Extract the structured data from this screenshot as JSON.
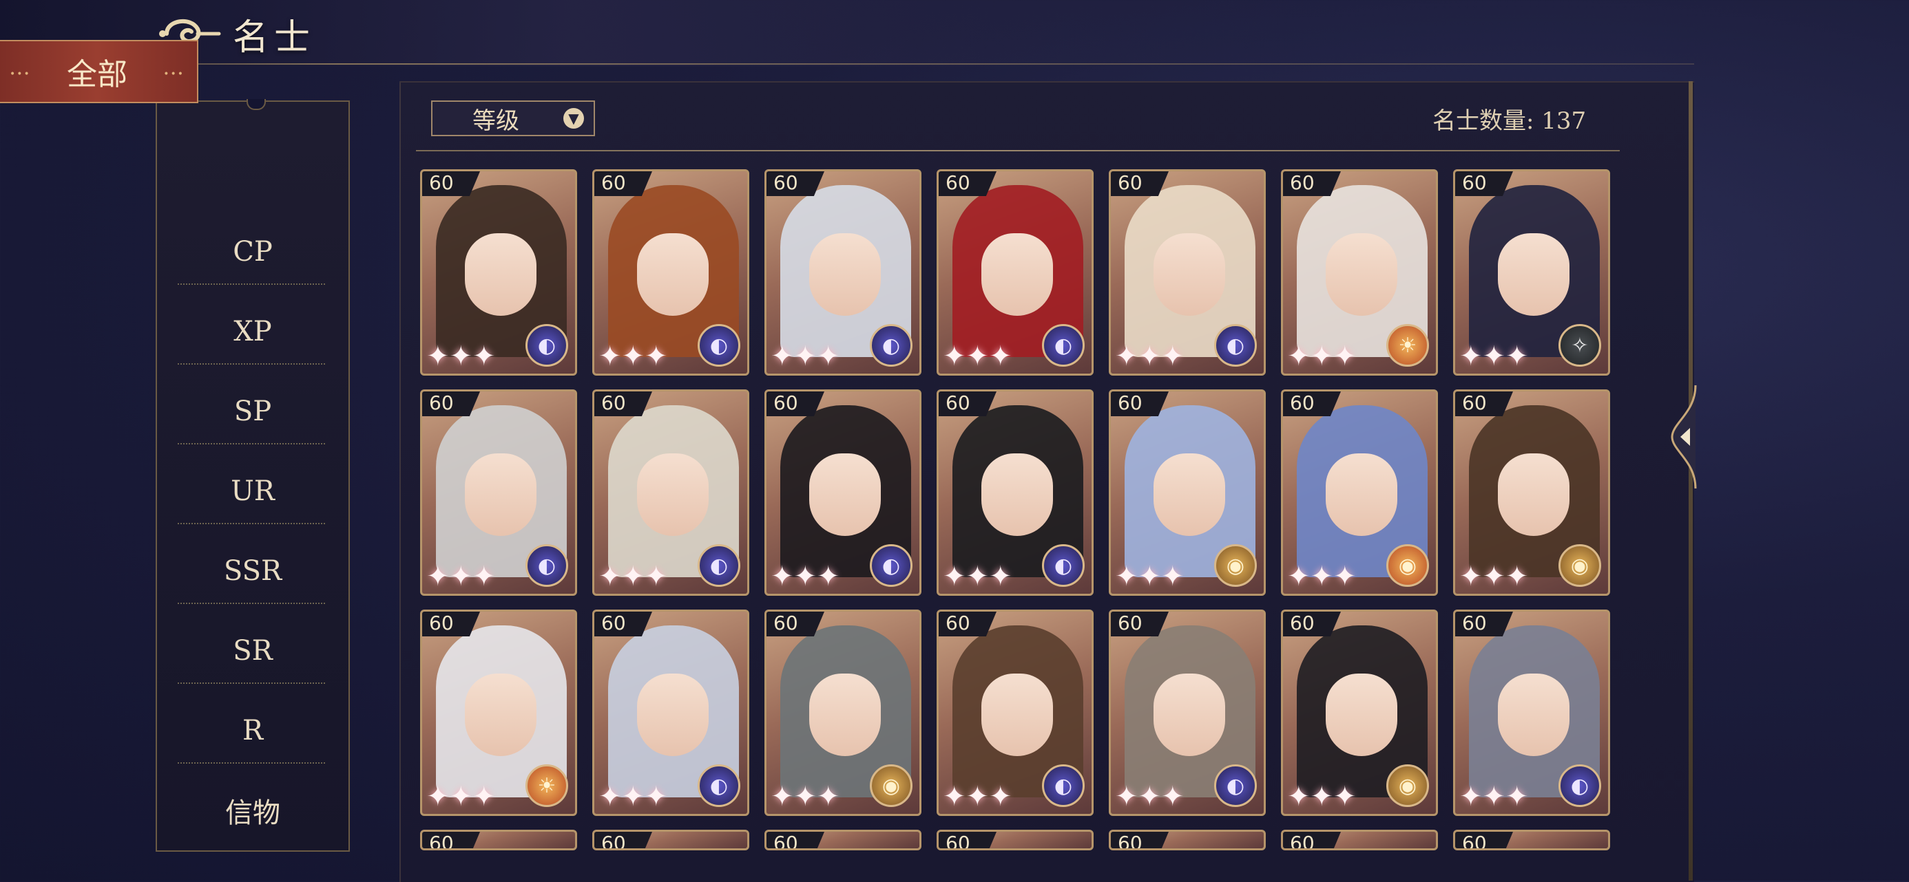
{
  "header": {
    "title": "名士"
  },
  "sidebar": {
    "active": "全部",
    "items": [
      "CP",
      "XP",
      "SP",
      "UR",
      "SSR",
      "SR",
      "R",
      "信物"
    ]
  },
  "toolbar": {
    "sort_label": "等级",
    "count_label": "名士数量:",
    "count_value": "137"
  },
  "cards": [
    {
      "level": "60",
      "hair": "#3a2a22",
      "badge": "purple",
      "glyph": "◐",
      "stars": "✦✦✦"
    },
    {
      "level": "60",
      "hair": "#9a4a24",
      "badge": "purple",
      "glyph": "◐",
      "stars": "✦✦✦"
    },
    {
      "level": "60",
      "hair": "#d6dbe6",
      "badge": "purple",
      "glyph": "◐",
      "stars": "✦✦✦"
    },
    {
      "level": "60",
      "hair": "#a21d22",
      "badge": "purple",
      "glyph": "◐",
      "stars": "✦✦✦"
    },
    {
      "level": "60",
      "hair": "#eadbc8",
      "badge": "purple",
      "glyph": "◐",
      "stars": "✦✦✦"
    },
    {
      "level": "60",
      "hair": "#e8e2de",
      "badge": "fire",
      "glyph": "☀",
      "stars": "✦✦✦"
    },
    {
      "level": "60",
      "hair": "#20223e",
      "badge": "dark",
      "glyph": "✧",
      "stars": "✦✦✦"
    },
    {
      "level": "60",
      "hair": "#cfcfcf",
      "badge": "purple",
      "glyph": "◐",
      "stars": "✦✦✦"
    },
    {
      "level": "60",
      "hair": "#ddd8cc",
      "badge": "purple",
      "glyph": "◐",
      "stars": "✦✦✦"
    },
    {
      "level": "60",
      "hair": "#1c1a1e",
      "badge": "purple",
      "glyph": "◐",
      "stars": "✦✦✦"
    },
    {
      "level": "60",
      "hair": "#1b1c1f",
      "badge": "purple",
      "glyph": "◐",
      "stars": "✦✦✦"
    },
    {
      "level": "60",
      "hair": "#9fb3df",
      "badge": "gold",
      "glyph": "◉",
      "stars": "✦✦✦"
    },
    {
      "level": "60",
      "hair": "#6f86c8",
      "badge": "fire",
      "glyph": "◉",
      "stars": "✦✦✦"
    },
    {
      "level": "60",
      "hair": "#4a3426",
      "badge": "gold",
      "glyph": "◉",
      "stars": "✦✦✦"
    },
    {
      "level": "60",
      "hair": "#e6e6ea",
      "badge": "fire",
      "glyph": "☀",
      "stars": "✦✦✦"
    },
    {
      "level": "60",
      "hair": "#c8cfe0",
      "badge": "purple",
      "glyph": "◐",
      "stars": "✦✦✦"
    },
    {
      "level": "60",
      "hair": "#6d7478",
      "badge": "gold",
      "glyph": "◉",
      "stars": "✦✦✦"
    },
    {
      "level": "60",
      "hair": "#5a3e2e",
      "badge": "purple",
      "glyph": "◐",
      "stars": "✦✦✦"
    },
    {
      "level": "60",
      "hair": "#8a7e74",
      "badge": "purple",
      "glyph": "◐",
      "stars": "✦✦✦"
    },
    {
      "level": "60",
      "hair": "#1e1d22",
      "badge": "gold",
      "glyph": "◉",
      "stars": "✦✦✦"
    },
    {
      "level": "60",
      "hair": "#7a7f94",
      "badge": "purple",
      "glyph": "◐",
      "stars": "✦✦✦"
    }
  ],
  "partial_row_levels": [
    "60",
    "60",
    "60",
    "60",
    "60",
    "60",
    "60"
  ]
}
